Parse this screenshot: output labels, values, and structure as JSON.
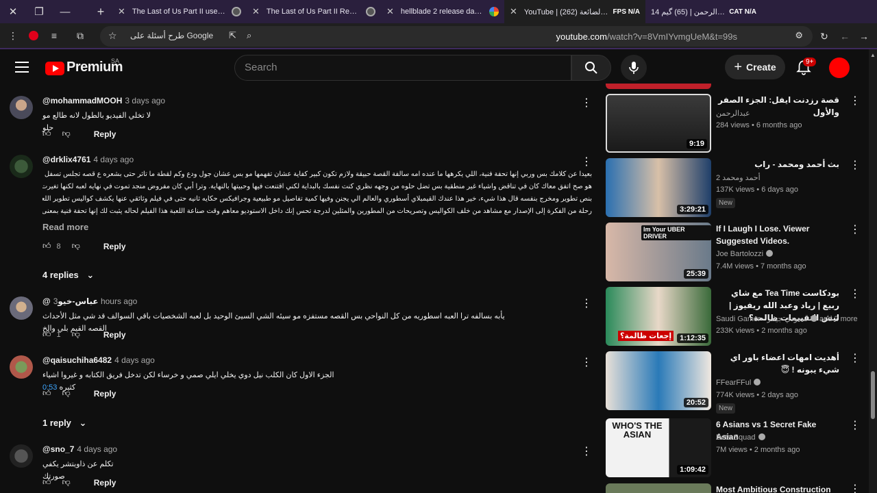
{
  "browser": {
    "tabs": [
      {
        "title": "The Last of Us Part II user reviews",
        "extra": ""
      },
      {
        "title": "The Last of Us Part II Reviews - M",
        "extra": ""
      },
      {
        "title": "hellblade 2 release date - Google",
        "extra": ""
      },
      {
        "title": "YouTube | الفرصة الضائعة (262)",
        "extra": "FPS N/A"
      },
      {
        "title": "عبدالرحمن | (65) گيم 14",
        "extra": "CAT N/A"
      }
    ],
    "address": {
      "ask_label": "طرح أسئلة على Google",
      "url_host": "youtube.com",
      "url_path": "/watch?v=8VmIYvmgUeM&t=99s"
    }
  },
  "header": {
    "logo": "Premium",
    "region": "SA",
    "search_placeholder": "Search",
    "create_label": "Create",
    "notifications": "9+"
  },
  "comments": [
    {
      "handle": "@mohammadMOOH",
      "time": "3 days ago",
      "text": "لا تخلي الفيديو بالطول لانه طالع مو حلو",
      "likes": "",
      "reply_label": "Reply"
    },
    {
      "handle": "@drklix4761",
      "time": "4 days ago",
      "text_lines": [
        "بعيدا عن كلامك بس وربي إنها تحفة فنية، اللي يكرهها ما عنده امه سالفة القصة حبيقة ولازم تكون كبير كفاية عشان تفهمها مو بس عشان جول ودع وكم لقطة ما تاثر حتى بشعره ع قصه تجلس تسفل فيها",
        "هو صح اتفق معاك كان في تناقض واشياء غير منطقية بس تضل حلوه من وجهه نظري كنت نفسك بالبداية لكني اقتنعت فيها وحبيتها بالنهاية. وترا أبي كان مفروض منجد تموت في نهايه لعبه لكنها تغيرت",
        "بنص تطوير ومخرج بنفسه قال هذا شيء، خير هذا عندك القيمبلاي أسطوري والعالم الي يجنن وفيها كمية تفاصيل مو طبيعية وجرافيكس حكايه ثانيه حتى في فيلم وثائقي عنها يكشف كواليس تطوير اللعبة",
        "رحلة من الفكرة إلى الإصدار مع مشاهد من خلف الكواليس وتصريحات من المطورين والمثلين لدرجة تحس إنك داخل الاستوديو معاهم وقت صناعة اللعبة هذا الفيلم لحاله يثبت لك إنها تحفة فنية بمعنى..."
      ],
      "read_more": "Read more",
      "likes": "8",
      "reply_label": "Reply",
      "replies": "4 replies"
    },
    {
      "handle": "@عباس-خيو",
      "time": "3 hours ago",
      "text": "يأبه بسالفه ترا العبه اسطوريه من كل النواحي بس القصه مستفزه مو سيئه الشي السيئ الوحيد بل لعبه الشخصيات باقي السوالف قد شي مثل الأحداث القصه القيم بلي والخ",
      "likes": "1",
      "reply_label": "Reply"
    },
    {
      "handle": "@qaisuchiha6482",
      "time": "4 days ago",
      "timestamp": "0:53",
      "text": "الجزء الاول كان الكلب نيل دوي يخلي ايلي صمي و خرساء لكن تدخل فريق الكتابه و غيروا اشياء كثيره",
      "likes": "",
      "reply_label": "Reply",
      "replies": "1 reply"
    },
    {
      "handle": "@sno_7",
      "time": "4 days ago",
      "text": "تكلم عن ذاويتشر يكفي صورتك",
      "likes": "",
      "reply_label": "Reply"
    }
  ],
  "videos": [
    {
      "title": "قصة رزدنت ايفل: الجزء الصفر والأول",
      "channel": "عبدالرحمن",
      "meta": "284 views • 6 months ago",
      "duration": "9:19",
      "rtl": true,
      "new": ""
    },
    {
      "title": "بث أحمد ومحمد - راب",
      "channel": "أحمد ومحمد 2",
      "meta": "137K views • 6 days ago",
      "duration": "3:29:21",
      "rtl": true,
      "new": "New"
    },
    {
      "title": "If I Laugh I Lose. Viewer Suggested Videos.",
      "channel": "Joe Bartolozzi",
      "meta": "7.4M views • 7 months ago",
      "duration": "25:39",
      "rtl": false,
      "new": "",
      "thumb_text": "Im Your UBER DRIVER"
    },
    {
      "title": "بودكاست Tea Time مع شاي ربيع | رياد وعبد الله ريفيوز | ليش التقييمات ظالمة؟",
      "channel": "Saudi Gamer - سعودي جيمر",
      "channel_extra": "and 2 more",
      "meta": "233K views • 2 months ago",
      "duration": "1:12:35",
      "rtl": true,
      "new": "",
      "thumb_text": "إجعات ظالمة؟"
    },
    {
      "title": "أهديت امهات اعضاء باور اي شيء يبونه ! 😇",
      "channel": "FFearFFul",
      "meta": "774K views • 2 days ago",
      "duration": "20:52",
      "rtl": true,
      "new": "New"
    },
    {
      "title": "6 Asians vs 1 Secret Fake Asian",
      "channel": "Beta Squad",
      "meta": "7M views • 2 months ago",
      "duration": "1:09:42",
      "rtl": false,
      "new": "",
      "thumb_text": "WHO'S THE ASIAN"
    },
    {
      "title": "Most Ambitious Construction",
      "channel": "",
      "meta": "",
      "duration": "",
      "rtl": false,
      "new": ""
    }
  ],
  "colors": {
    "accent": "#ff0000",
    "link": "#3ea6ff",
    "tabbar": "#2a1f3d"
  }
}
